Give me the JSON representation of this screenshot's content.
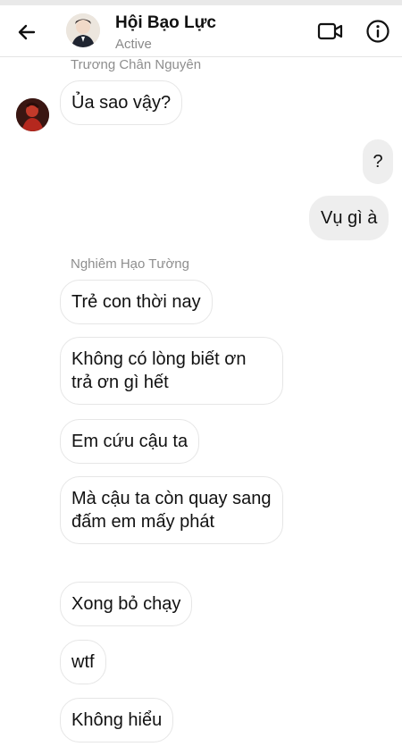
{
  "header": {
    "title": "Hội Bạo Lực",
    "status": "Active"
  },
  "icons": {
    "back": "arrow-left-icon",
    "video": "video-call-icon",
    "info": "info-icon"
  },
  "colors": {
    "incoming_bubble": "#ffffff",
    "incoming_border": "#e6e6e6",
    "outgoing_bubble": "#eeeeee",
    "sender_name": "#8e8e8e"
  },
  "messages": [
    {
      "sender": "Trương Chân Nguyên",
      "text": "Ủa sao vậy?",
      "direction": "incoming"
    },
    {
      "text": "?",
      "direction": "outgoing"
    },
    {
      "text": "Vụ gì à",
      "direction": "outgoing"
    },
    {
      "sender": "Nghiêm Hạo Tường",
      "text": "Trẻ con thời nay",
      "direction": "incoming"
    },
    {
      "text": "Không có lòng biết ơn trả ơn gì hết",
      "direction": "incoming"
    },
    {
      "text": "Em cứu cậu ta",
      "direction": "incoming"
    },
    {
      "text": "Mà cậu ta còn quay sang đấm em mấy phát",
      "direction": "incoming"
    },
    {
      "text": "Xong bỏ chạy",
      "direction": "incoming"
    },
    {
      "text": "wtf",
      "direction": "incoming"
    },
    {
      "text": "Không hiểu",
      "direction": "incoming"
    }
  ]
}
